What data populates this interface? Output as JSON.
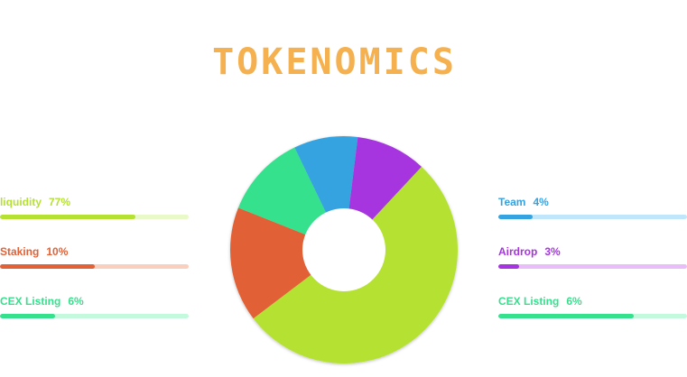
{
  "title": "TOKENOMICS",
  "left_stats": [
    {
      "label": "liquidity",
      "percent": "77%",
      "fill": 0.72,
      "color": "#b5e133",
      "track": "#e9f9c8"
    },
    {
      "label": "Staking",
      "percent": "10%",
      "fill": 0.5,
      "color": "#e26136",
      "track": "#fbcfbd"
    },
    {
      "label": "CEX Listing",
      "percent": "6%",
      "fill": 0.29,
      "color": "#35e18d",
      "track": "#c4f9de"
    }
  ],
  "right_stats": [
    {
      "label": "Team",
      "percent": "4%",
      "fill": 0.18,
      "color": "#35a3e0",
      "track": "#c0e6fb"
    },
    {
      "label": "Airdrop",
      "percent": "3%",
      "fill": 0.11,
      "color": "#a634e0",
      "track": "#e8bdfa"
    },
    {
      "label": "CEX Listing",
      "percent": "6%",
      "fill": 0.72,
      "color": "#35e18d",
      "track": "#c4f9de"
    }
  ],
  "chart_data": {
    "type": "pie",
    "donut": true,
    "slices": [
      {
        "value": 58,
        "color": "#b5e133"
      },
      {
        "value": 18,
        "color": "#e26136"
      },
      {
        "value": 13,
        "color": "#35e18d"
      },
      {
        "value": 10,
        "color": "#35a3e0"
      },
      {
        "value": 11,
        "color": "#a634e0"
      }
    ]
  }
}
